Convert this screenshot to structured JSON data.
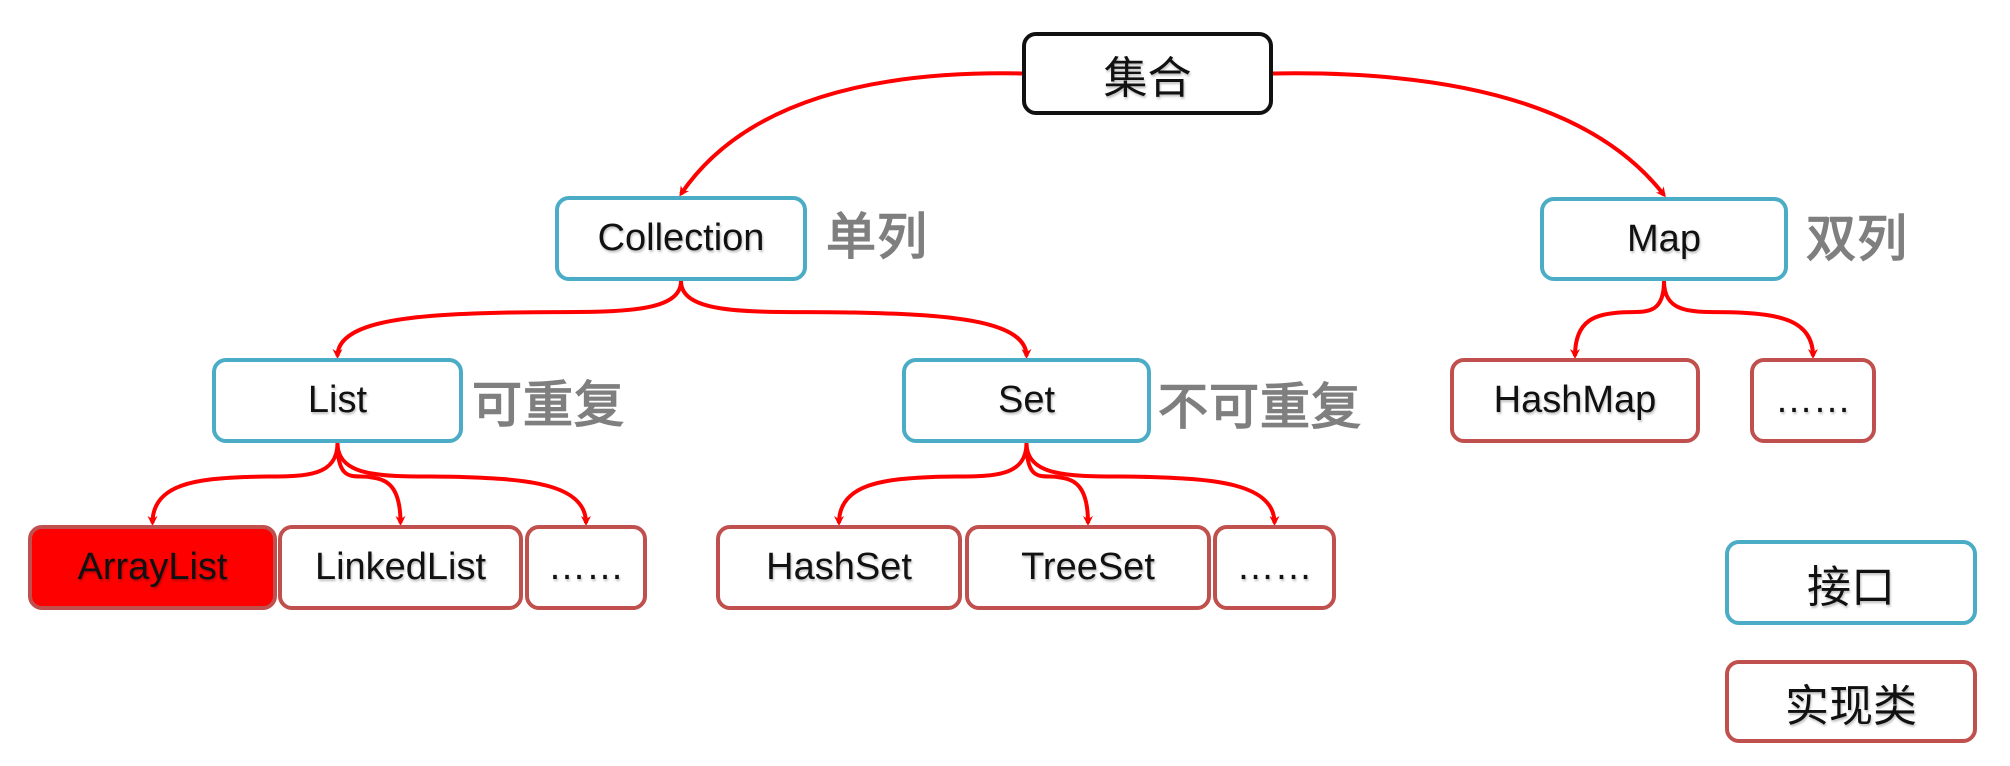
{
  "diagram": {
    "nodes": [
      {
        "id": "root",
        "label": "集合",
        "kind": "root"
      },
      {
        "id": "collection",
        "label": "Collection",
        "kind": "interface"
      },
      {
        "id": "map",
        "label": "Map",
        "kind": "interface"
      },
      {
        "id": "list",
        "label": "List",
        "kind": "interface"
      },
      {
        "id": "set",
        "label": "Set",
        "kind": "interface"
      },
      {
        "id": "arraylist",
        "label": "ArrayList",
        "kind": "impl",
        "highlighted": true
      },
      {
        "id": "linkedlist",
        "label": "LinkedList",
        "kind": "impl"
      },
      {
        "id": "list-more",
        "label": "……",
        "kind": "impl"
      },
      {
        "id": "hashset",
        "label": "HashSet",
        "kind": "impl"
      },
      {
        "id": "treeset",
        "label": "TreeSet",
        "kind": "impl"
      },
      {
        "id": "set-more",
        "label": "……",
        "kind": "impl"
      },
      {
        "id": "hashmap",
        "label": "HashMap",
        "kind": "impl"
      },
      {
        "id": "map-more",
        "label": "……",
        "kind": "impl"
      }
    ],
    "edges": [
      {
        "from": "root",
        "to": "collection"
      },
      {
        "from": "root",
        "to": "map"
      },
      {
        "from": "collection",
        "to": "list"
      },
      {
        "from": "collection",
        "to": "set"
      },
      {
        "from": "list",
        "to": "arraylist"
      },
      {
        "from": "list",
        "to": "linkedlist"
      },
      {
        "from": "list",
        "to": "list-more"
      },
      {
        "from": "set",
        "to": "hashset"
      },
      {
        "from": "set",
        "to": "treeset"
      },
      {
        "from": "set",
        "to": "set-more"
      },
      {
        "from": "map",
        "to": "hashmap"
      },
      {
        "from": "map",
        "to": "map-more"
      }
    ],
    "annotations": {
      "collection": "单列",
      "map": "双列",
      "list": "可重复",
      "set": "不可重复"
    },
    "legend": {
      "interface": "接口",
      "impl": "实现类"
    },
    "colors": {
      "edge": "#ff0000",
      "interface_border": "#4bacc6",
      "impl_border": "#c0504d",
      "highlight_fill": "#ff0000",
      "annotation_text": "#7f7f7f"
    }
  }
}
